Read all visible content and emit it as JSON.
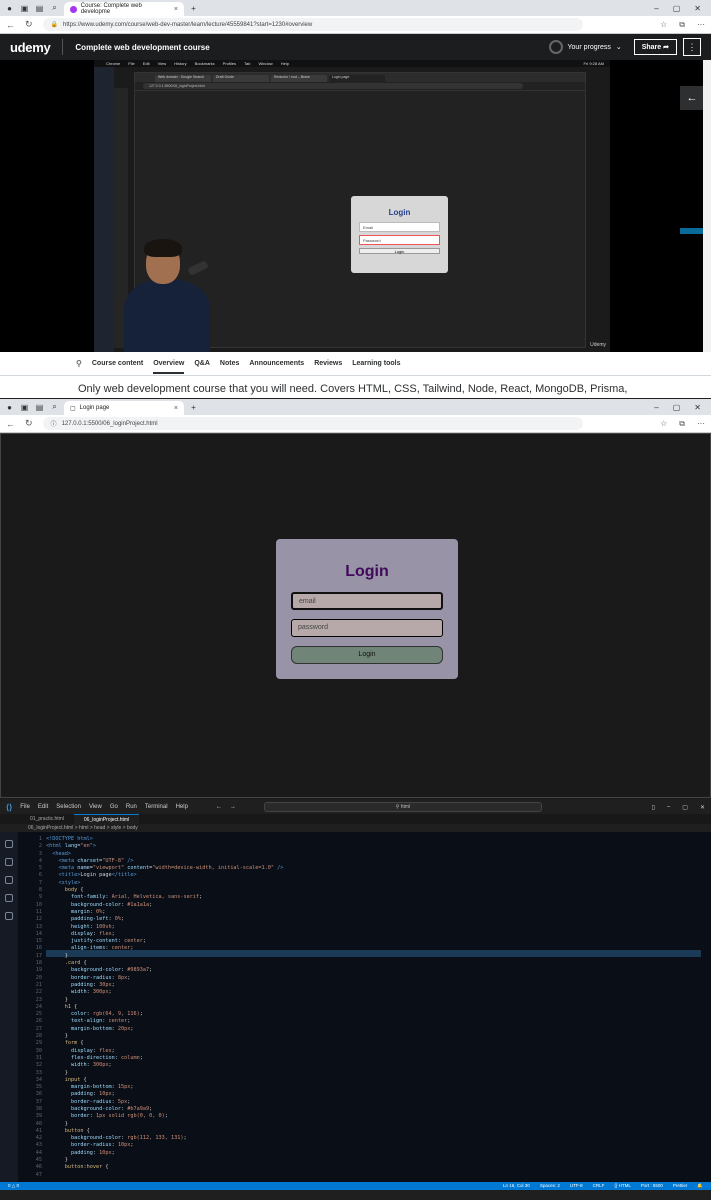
{
  "browser1": {
    "tab_title": "Course: Complete web developme",
    "url": "https://www.udemy.com/course/web-dev-master/learn/lecture/45559841?start=1230#overview"
  },
  "udemy": {
    "logo": "udemy",
    "course_title": "Complete web development course",
    "progress_label": "Your progress",
    "share_label": "Share",
    "tabs": [
      "Course content",
      "Overview",
      "Q&A",
      "Notes",
      "Announcements",
      "Reviews",
      "Learning tools"
    ],
    "description": "Only web development course that you will need. Covers HTML, CSS, Tailwind, Node, React, MongoDB, Prisma,"
  },
  "video": {
    "inner_tabs": [
      "Web domain · Google Search",
      "Draft Guide",
      "Redcolor / root – Brave",
      "Login page"
    ],
    "inner_url": "127.0.0.1:5500/06_loginProject.html",
    "login_title": "Login",
    "email_placeholder": "Email",
    "password_placeholder": "Password",
    "button_label": "Login",
    "explorer_label": "EXPLOR",
    "brand_watermark": "Udemy",
    "clock": "Fri 9:28 AM"
  },
  "browser2": {
    "tab_title": "Login page",
    "url": "127.0.0.1:5500/06_loginProject.html",
    "login_title": "Login",
    "email_placeholder": "email",
    "password_placeholder": "password",
    "button_label": "Login"
  },
  "vscode": {
    "menu": [
      "File",
      "Edit",
      "Selection",
      "View",
      "Go",
      "Run",
      "Terminal",
      "Help"
    ],
    "search": "html",
    "tabs": [
      "01_practic.html",
      "06_loginProject.html"
    ],
    "breadcrumb": "06_loginProject.html > html > head > style > body",
    "status_left": "0 △ 0",
    "status_right": [
      "Ln 16, Col 30",
      "Spaces: 2",
      "UTF-8",
      "CRLF",
      "{} HTML",
      "Port : 5500",
      "Prettier"
    ],
    "colors": {
      "accent": "#0078d4",
      "card": "#9893a7",
      "login_title": "#40095a",
      "input": "#b7a9a9",
      "button": "#708577"
    }
  }
}
